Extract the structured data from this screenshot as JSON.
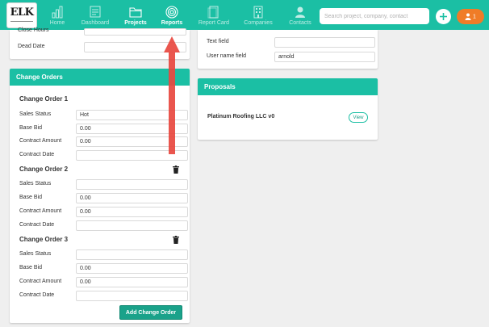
{
  "nav": {
    "logo": "ELK",
    "items": [
      {
        "label": "Home",
        "icon": "bar-chart-icon"
      },
      {
        "label": "Dashboard",
        "icon": "dashboard-icon"
      },
      {
        "label": "Projects",
        "icon": "folder-icon"
      },
      {
        "label": "Reports",
        "icon": "target-icon"
      },
      {
        "label": "Report Card",
        "icon": "report-card-icon"
      },
      {
        "label": "Companies",
        "icon": "building-icon"
      },
      {
        "label": "Contacts",
        "icon": "person-icon"
      }
    ],
    "search_placeholder": "Search project, company, contact",
    "plus": "+",
    "user_badge": "1"
  },
  "details": {
    "close_hours_label": "Close Hours",
    "dead_date_label": "Dead Date"
  },
  "right_fields": {
    "text_field_label": "Text field",
    "user_name_label": "User name field",
    "user_name_value": "arnold"
  },
  "change_orders": {
    "title": "Change Orders",
    "orders": [
      {
        "title": "Change Order 1",
        "sales_status_label": "Sales Status",
        "sales_status": "Hot",
        "base_bid_label": "Base Bid",
        "base_bid": "0.00",
        "contract_amount_label": "Contract Amount",
        "contract_amount": "0.00",
        "contract_date_label": "Contract Date",
        "contract_date": ""
      },
      {
        "title": "Change Order 2",
        "sales_status_label": "Sales Status",
        "sales_status": "",
        "base_bid_label": "Base Bid",
        "base_bid": "0.00",
        "contract_amount_label": "Contract Amount",
        "contract_amount": "0.00",
        "contract_date_label": "Contract Date",
        "contract_date": ""
      },
      {
        "title": "Change Order 3",
        "sales_status_label": "Sales Status",
        "sales_status": "",
        "base_bid_label": "Base Bid",
        "base_bid": "0.00",
        "contract_amount_label": "Contract Amount",
        "contract_amount": "0.00",
        "contract_date_label": "Contract Date",
        "contract_date": ""
      }
    ],
    "add_button": "Add Change Order"
  },
  "proposals": {
    "title": "Proposals",
    "item": "Platinum Roofing LLC v0",
    "view_button": "View"
  },
  "colors": {
    "brand": "#1bbfa4",
    "button": "#1aa28a",
    "annotation_arrow": "#e8483f",
    "user_badge": "#f07c27"
  }
}
